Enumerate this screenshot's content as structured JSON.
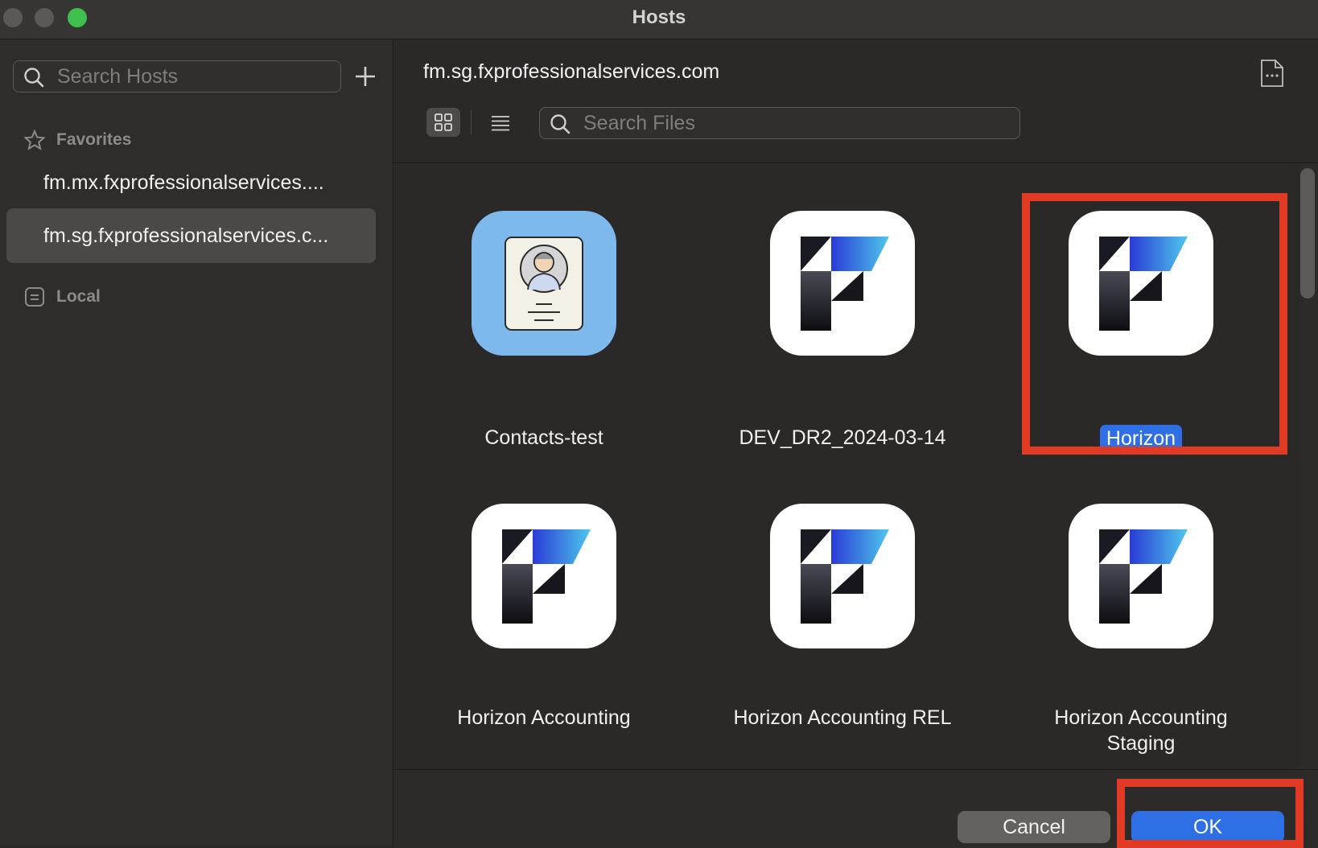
{
  "window": {
    "title": "Hosts"
  },
  "sidebar": {
    "search": {
      "placeholder": "Search Hosts",
      "value": ""
    },
    "favorites_label": "Favorites",
    "favorites": [
      {
        "label": "fm.mx.fxprofessionalservices...."
      },
      {
        "label": "fm.sg.fxprofessionalservices.c..."
      }
    ],
    "local_label": "Local"
  },
  "main": {
    "host_title": "fm.sg.fxprofessionalservices.com",
    "file_search": {
      "placeholder": "Search Files",
      "value": ""
    },
    "files": [
      {
        "name": "Contacts-test",
        "icon": "contacts-app-icon"
      },
      {
        "name": "DEV_DR2_2024-03-14",
        "icon": "filemaker-app-icon"
      },
      {
        "name": "Horizon",
        "icon": "filemaker-app-icon",
        "selected": true
      },
      {
        "name": "Horizon Accounting",
        "icon": "filemaker-app-icon"
      },
      {
        "name": "Horizon Accounting REL",
        "icon": "filemaker-app-icon"
      },
      {
        "name": "Horizon Accounting Staging",
        "icon": "filemaker-app-icon"
      }
    ]
  },
  "footer": {
    "cancel_label": "Cancel",
    "ok_label": "OK"
  },
  "colors": {
    "accent": "#2f6fe6",
    "highlight": "#e13b26"
  }
}
